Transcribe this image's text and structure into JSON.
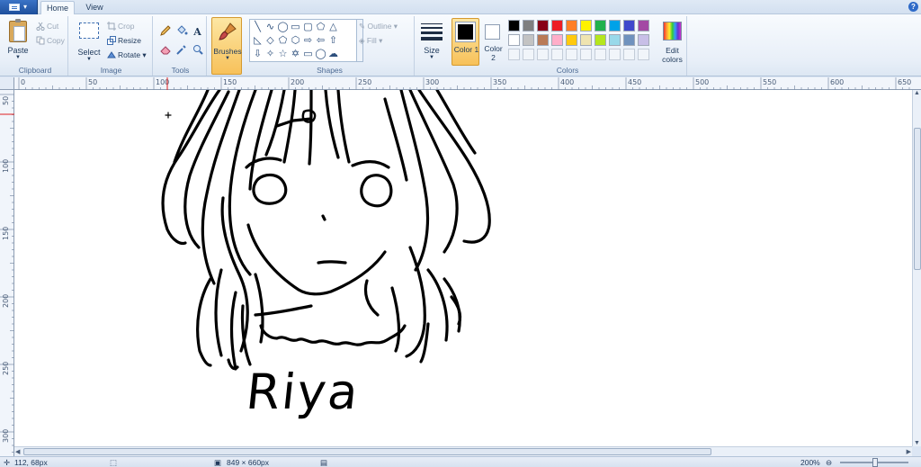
{
  "tabs": {
    "home": "Home",
    "view": "View"
  },
  "help_icon": "?",
  "clipboard": {
    "paste": "Paste",
    "cut": "Cut",
    "copy": "Copy",
    "label": "Clipboard"
  },
  "image": {
    "select": "Select",
    "crop": "Crop",
    "resize": "Resize",
    "rotate": "Rotate",
    "label": "Image"
  },
  "tools": {
    "label": "Tools",
    "text_tool": "A"
  },
  "brushes": {
    "label": "Brushes"
  },
  "shapes": {
    "outline": "Outline",
    "fill": "Fill",
    "label": "Shapes"
  },
  "size": {
    "label": "Size"
  },
  "colors": {
    "color1_label": "Color 1",
    "color2_label": "Color 2",
    "edit_label": "Edit colors",
    "group_label": "Colors",
    "color1_value": "#000000",
    "color2_value": "#ffffff",
    "palette_row1": [
      "#000000",
      "#7f7f7f",
      "#880015",
      "#ed1c24",
      "#ff7f27",
      "#fff200",
      "#22b14c",
      "#00a2e8",
      "#3f48cc",
      "#a349a4"
    ],
    "palette_row2": [
      "#ffffff",
      "#c3c3c3",
      "#b97a57",
      "#ffaec9",
      "#ffc90e",
      "#efe4b0",
      "#b5e61d",
      "#99d9ea",
      "#7092be",
      "#c8bfe7"
    ]
  },
  "ruler": {
    "h_labels": [
      "0",
      "50",
      "100",
      "150",
      "200",
      "250",
      "300",
      "350",
      "400",
      "450",
      "500",
      "550",
      "600",
      "650"
    ],
    "v_labels": [
      "50",
      "100",
      "150",
      "200",
      "250",
      "300"
    ]
  },
  "drawing": {
    "text": "Riya"
  },
  "status": {
    "cursor": "112, 68px",
    "size": "849 × 660px",
    "zoom": "200%"
  }
}
